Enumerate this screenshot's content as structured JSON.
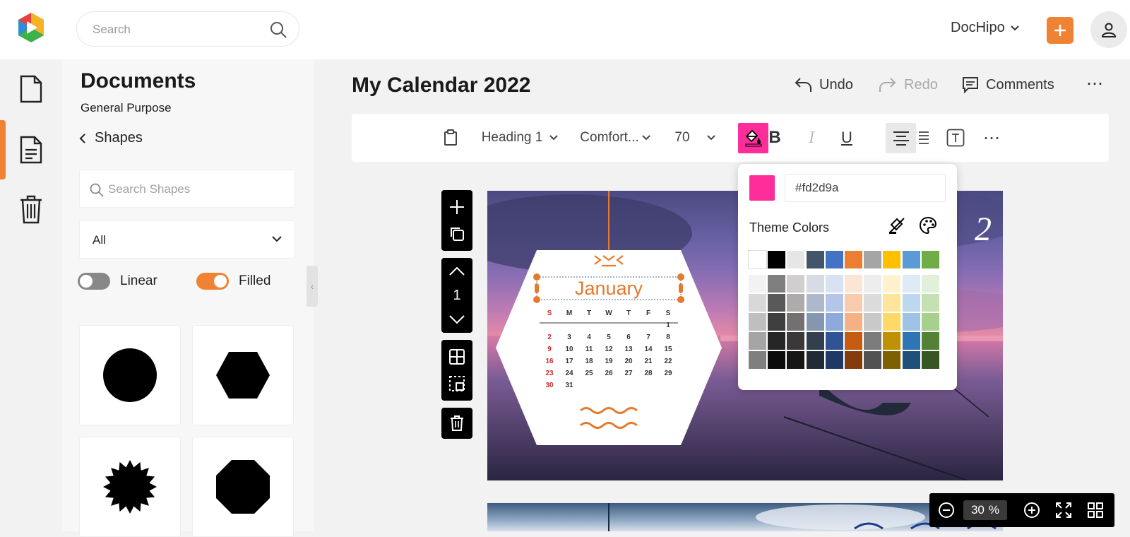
{
  "header": {
    "search_placeholder": "Search",
    "brand_menu": "DocHipo",
    "add_label": "+"
  },
  "sidebar": {
    "items": [
      "documents",
      "templates",
      "trash"
    ]
  },
  "panel": {
    "title": "Documents",
    "subtitle": "General Purpose",
    "back_label": "Shapes",
    "search_placeholder": "Search Shapes",
    "filter_value": "All",
    "toggle_linear": "Linear",
    "toggle_filled": "Filled",
    "shapes": [
      "circle",
      "hexagon",
      "starburst",
      "octagon"
    ]
  },
  "editor": {
    "doc_title": "My Calendar 2022",
    "undo": "Undo",
    "redo": "Redo",
    "comments": "Comments",
    "more": "⋯"
  },
  "toolbar": {
    "text_style": "Heading 1",
    "font": "Comfort...",
    "font_size": "70",
    "bold": "B",
    "italic": "I",
    "underline": "U",
    "more": "⋯"
  },
  "page_tools": {
    "page_number": "1"
  },
  "calendar": {
    "month": "January",
    "weekdays": [
      "S",
      "M",
      "T",
      "W",
      "T",
      "F",
      "S"
    ],
    "weeks": [
      [
        "",
        "",
        "",
        "",
        "",
        "",
        "1"
      ],
      [
        "2",
        "3",
        "4",
        "5",
        "6",
        "7",
        "8"
      ],
      [
        "9",
        "10",
        "11",
        "12",
        "13",
        "14",
        "15"
      ],
      [
        "16",
        "17",
        "18",
        "19",
        "20",
        "21",
        "22"
      ],
      [
        "23",
        "24",
        "25",
        "26",
        "27",
        "28",
        "29"
      ],
      [
        "30",
        "31",
        "",
        "",
        "",
        "",
        ""
      ]
    ]
  },
  "color_picker": {
    "hex_value": "#fd2d9a",
    "theme_label": "Theme Colors",
    "current_color": "#fd2d9a",
    "base_colors": [
      "#ffffff",
      "#000000",
      "#e7e6e6",
      "#44546a",
      "#4472c4",
      "#ed7d31",
      "#a5a5a5",
      "#ffc000",
      "#5b9bd5",
      "#70ad47"
    ],
    "shade_rows": [
      [
        "#f2f2f2",
        "#7f7f7f",
        "#d0cece",
        "#d6dce4",
        "#d9e2f3",
        "#fbe5d5",
        "#ededed",
        "#fff2cc",
        "#deebf6",
        "#e2efd9"
      ],
      [
        "#d8d8d8",
        "#595959",
        "#aeabab",
        "#adb9ca",
        "#b4c6e7",
        "#f7cbac",
        "#dbdbdb",
        "#fee599",
        "#bdd7ee",
        "#c5e0b3"
      ],
      [
        "#bfbfbf",
        "#3f3f3f",
        "#757070",
        "#8496b0",
        "#8eaadb",
        "#f4b183",
        "#c9c9c9",
        "#ffd965",
        "#9dc3e6",
        "#a8d08d"
      ],
      [
        "#a5a5a5",
        "#262626",
        "#3a3838",
        "#323f4f",
        "#2f5496",
        "#c55a11",
        "#7b7b7b",
        "#bf9000",
        "#2e75b5",
        "#538135"
      ],
      [
        "#7f7f7f",
        "#0c0c0c",
        "#171616",
        "#222a35",
        "#1f3864",
        "#833c0b",
        "#525252",
        "#7f6000",
        "#1e4e79",
        "#375623"
      ]
    ]
  },
  "zoom": {
    "value": "30",
    "unit": "%"
  },
  "colors": {
    "accent": "#f08333",
    "selected_fill": "#fd2d9a"
  }
}
